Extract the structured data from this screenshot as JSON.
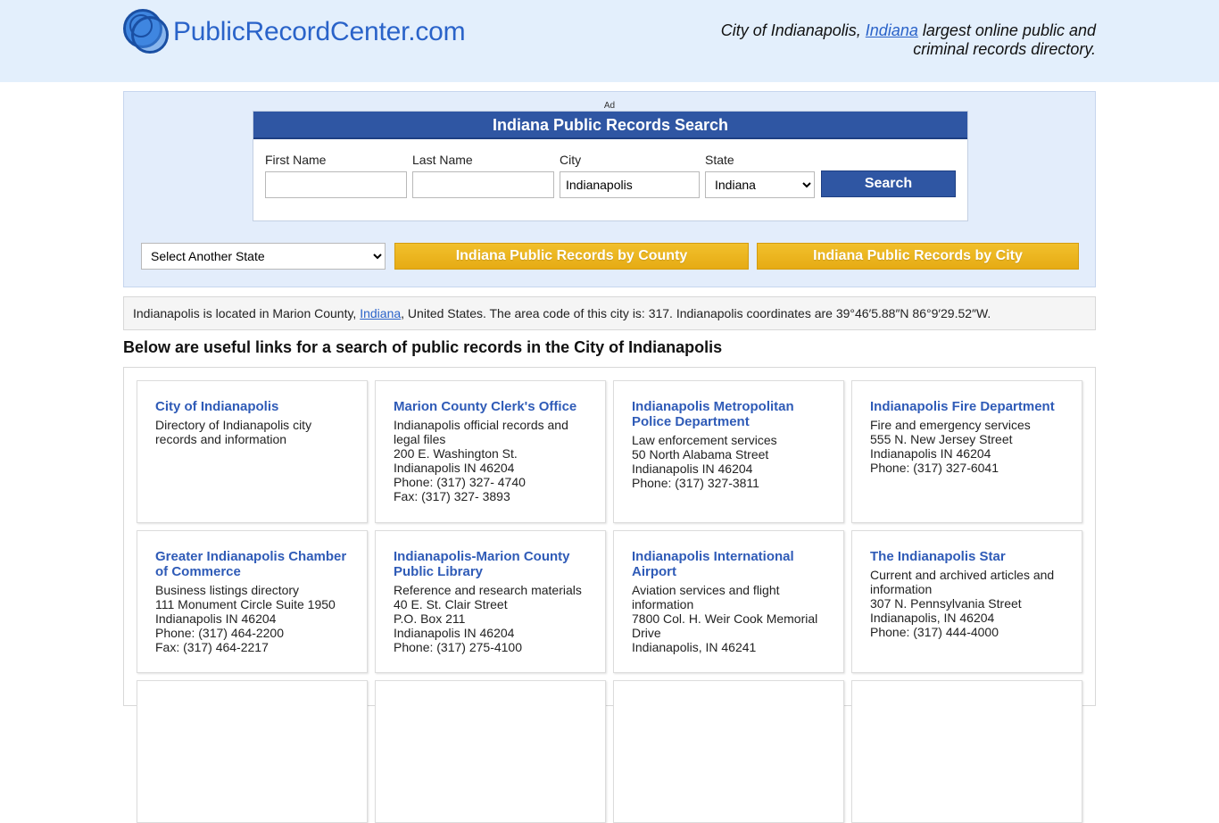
{
  "header": {
    "logo_text": "PublicRecordCenter.com",
    "tagline_pre": "City of Indianapolis, ",
    "tagline_link": "Indiana",
    "tagline_post": " largest online public and criminal records directory."
  },
  "search": {
    "ad_label": "Ad",
    "title": "Indiana Public Records Search",
    "first_name_label": "First Name",
    "first_name_value": "",
    "last_name_label": "Last Name",
    "last_name_value": "",
    "city_label": "City",
    "city_value": "Indianapolis",
    "state_label": "State",
    "state_value": "Indiana",
    "search_button": "Search"
  },
  "nav": {
    "state_select": "Select Another State",
    "county_button": "Indiana Public Records by County",
    "city_button": "Indiana Public Records by City"
  },
  "info": {
    "pre": "Indianapolis is located in Marion County, ",
    "link": "Indiana",
    "post": ", United States. The area code of this city is: 317. Indianapolis coordinates are 39°46′5.88″N 86°9′29.52″W."
  },
  "section_heading": "Below are useful links for a search of public records in the City of Indianapolis",
  "cards": [
    {
      "title": "City of Indianapolis",
      "lines": [
        "Directory of Indianapolis city",
        "records and information"
      ]
    },
    {
      "title": "Marion County Clerk's Office",
      "lines": [
        "Indianapolis official records and",
        "legal files",
        "200 E. Washington St.",
        "Indianapolis IN 46204",
        "Phone: (317) 327- 4740",
        "Fax: (317) 327- 3893"
      ]
    },
    {
      "title": "Indianapolis Metropolitan Police Department",
      "lines": [
        "Law enforcement services",
        "50 North Alabama Street",
        "Indianapolis IN 46204",
        "Phone: (317) 327-3811"
      ]
    },
    {
      "title": "Indianapolis Fire Department",
      "lines": [
        "Fire and emergency services",
        "555 N. New Jersey Street",
        "Indianapolis IN 46204",
        "Phone: (317) 327-6041"
      ]
    },
    {
      "title": "Greater Indianapolis Chamber of Commerce",
      "lines": [
        "Business listings directory",
        "111 Monument Circle Suite 1950",
        "Indianapolis IN 46204",
        "Phone: (317) 464-2200",
        "Fax: (317) 464-2217"
      ]
    },
    {
      "title": "Indianapolis-Marion County Public Library",
      "lines": [
        "Reference and research materials",
        "40 E. St. Clair Street",
        "P.O. Box 211",
        "Indianapolis IN 46204",
        "Phone: (317) 275-4100"
      ]
    },
    {
      "title": "Indianapolis International Airport",
      "lines": [
        "Aviation services and flight",
        "information",
        "7800 Col. H. Weir Cook Memorial",
        "Drive",
        "Indianapolis, IN 46241"
      ]
    },
    {
      "title": "The Indianapolis Star",
      "lines": [
        "Current and archived articles and",
        "information",
        "307 N. Pennsylvania Street",
        "Indianapolis, IN 46204",
        "Phone: (317) 444-4000"
      ]
    }
  ]
}
